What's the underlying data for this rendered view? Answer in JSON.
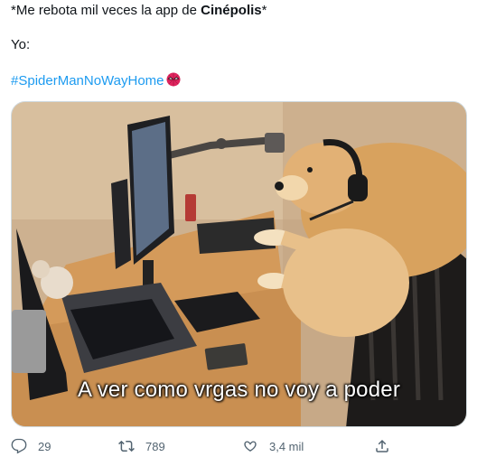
{
  "tweet": {
    "line1_prefix": "*Me rebota mil veces la app de ",
    "line1_bold": "Cinépolis",
    "line1_suffix": "*",
    "line2": "Yo:",
    "hashtag": "#SpiderManNoWayHome",
    "hashtag_color": "#1d9bf0"
  },
  "media": {
    "caption": "A ver como vrgas no voy a poder"
  },
  "actions": {
    "replies": "29",
    "retweets": "789",
    "likes": "3,4 mil",
    "icon_color": "#536471"
  }
}
